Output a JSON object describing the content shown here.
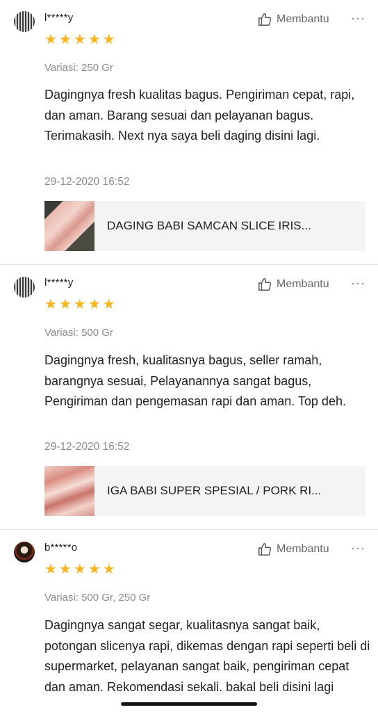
{
  "reviews": [
    {
      "username": "l*****y",
      "helpful_label": "Membantu",
      "more_label": "···",
      "rating": 5,
      "variation": "Variasi: 250 Gr",
      "text": "Dagingnya fresh kualitas bagus. Pengiriman cepat, rapi, dan aman. Barang sesuai dan pelayanan bagus. Terimakasih. Next nya saya beli daging disini lagi.",
      "datetime": "29-12-2020 16:52",
      "product_name": "DAGING BABI SAMCAN SLICE IRIS..."
    },
    {
      "username": "l*****y",
      "helpful_label": "Membantu",
      "more_label": "···",
      "rating": 5,
      "variation": "Variasi: 500 Gr",
      "text": "Dagingnya fresh, kualitasnya bagus, seller ramah, barangnya sesuai, Pelayanannya sangat bagus, Pengiriman dan pengemasan rapi dan aman. Top deh.",
      "datetime": "29-12-2020 16:52",
      "product_name": "IGA BABI SUPER SPESIAL / PORK RI..."
    },
    {
      "username": "b*****o",
      "helpful_label": "Membantu",
      "more_label": "···",
      "rating": 5,
      "variation": "Variasi: 500 Gr, 250 Gr",
      "text": "Dagingnya sangat segar, kualitasnya sangat baik, potongan slicenya rapi, dikemas dengan rapi seperti beli di supermarket, pelayanan sangat baik, pengiriman cepat dan aman. Rekomendasi sekali. bakal beli disini lagi"
    }
  ],
  "colors": {
    "star": "#f6b51e",
    "muted_text": "#8a8a8a",
    "product_card_bg": "#f4f4f4"
  },
  "icons": {
    "helpful": "thumbs-up-icon",
    "star": "star-icon",
    "more": "more-options-icon"
  }
}
